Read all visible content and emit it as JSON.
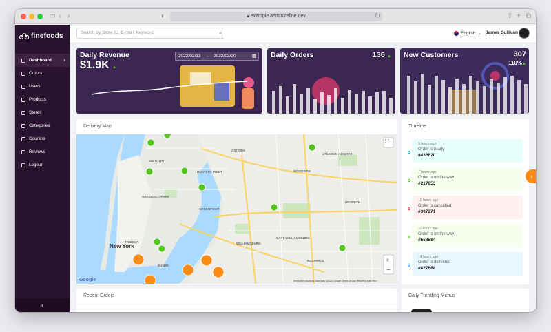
{
  "browser": {
    "url": "example.admin.refine.dev"
  },
  "brand": {
    "name": "finefoods",
    "accent": "#fa8c16"
  },
  "search": {
    "placeholder": "Search by Store ID, E-mail, Keyword"
  },
  "header": {
    "language": "English",
    "user_name": "James Sullivan"
  },
  "sidebar": {
    "items": [
      {
        "label": "Dashboard",
        "icon": "dashboard-icon",
        "active": true
      },
      {
        "label": "Orders",
        "icon": "orders-icon"
      },
      {
        "label": "Users",
        "icon": "users-icon"
      },
      {
        "label": "Products",
        "icon": "products-icon"
      },
      {
        "label": "Stores",
        "icon": "stores-icon"
      },
      {
        "label": "Categories",
        "icon": "categories-icon"
      },
      {
        "label": "Couriers",
        "icon": "couriers-icon"
      },
      {
        "label": "Reviews",
        "icon": "reviews-icon"
      },
      {
        "label": "Logout",
        "icon": "logout-icon"
      }
    ]
  },
  "kpis": {
    "revenue": {
      "title": "Daily Revenue",
      "value": "$1.9K",
      "date_start": "2022/02/13",
      "date_end": "2022/02/20"
    },
    "orders": {
      "title": "Daily Orders",
      "value": "136"
    },
    "customers": {
      "title": "New Customers",
      "value": "307",
      "percent": "110%"
    }
  },
  "map_panel": {
    "title": "Delivery Map",
    "labels": {
      "city": "New York",
      "google": "Google",
      "footer": "Keyboard shortcuts   Map data ©2022 Google   Terms of Use   Report a map error"
    },
    "places": [
      "JACKSON HEIGHTS",
      "WOODSIDE",
      "HUNTERS POINT",
      "ASTORIA",
      "GREENPOINT",
      "WILLIAMSBURG",
      "BUSHWICK",
      "GRAMERCY PARK",
      "TRIBECA",
      "DUMBO",
      "MIDTOWN",
      "EAST WILLIAMSBURG",
      "MASPETH"
    ]
  },
  "timeline": {
    "title": "Timeline",
    "items": [
      {
        "time": "5 hours ago",
        "text": "Order is ready",
        "order": "#436620",
        "bg": "#e6fffb",
        "color": "#13c2c2"
      },
      {
        "time": "7 hours ago",
        "text": "Order is on the way",
        "order": "#217853",
        "bg": "#f6ffed",
        "color": "#52c41a"
      },
      {
        "time": "10 hours ago",
        "text": "Order is cancelled",
        "order": "#337271",
        "bg": "#fff1f0",
        "color": "#f5222d"
      },
      {
        "time": "11 hours ago",
        "text": "Order is on the way",
        "order": "#558584",
        "bg": "#f6ffed",
        "color": "#52c41a"
      },
      {
        "time": "14 hours ago",
        "text": "Order is delivered",
        "order": "#827668",
        "bg": "#e6f7ff",
        "color": "#1890ff"
      }
    ]
  },
  "recent_orders": {
    "title": "Recent Orders"
  },
  "trending": {
    "title": "Daily Trending Menus"
  }
}
